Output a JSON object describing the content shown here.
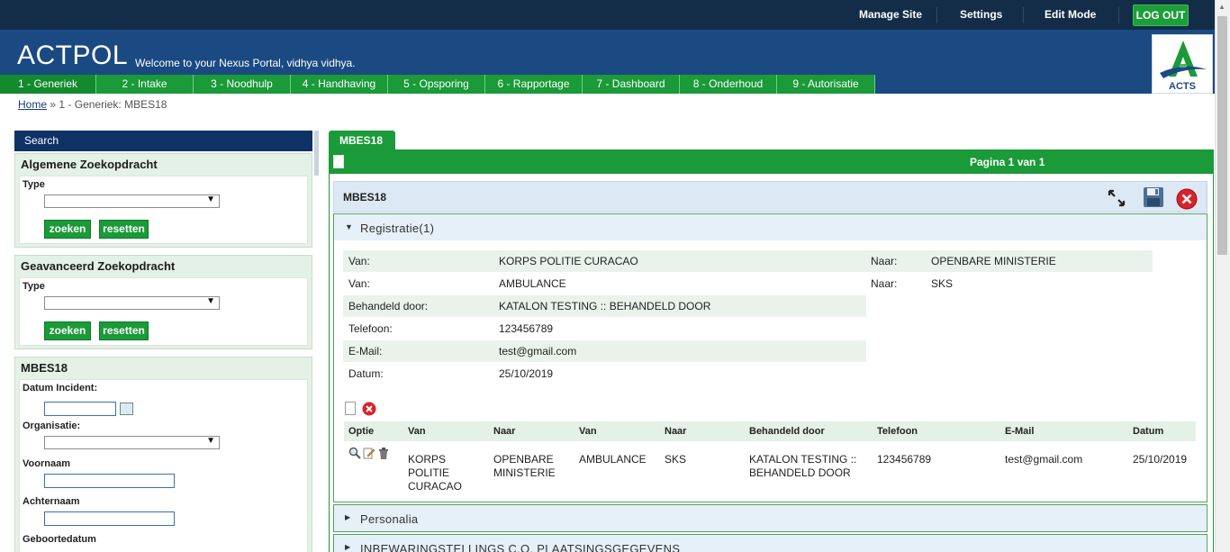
{
  "topbar": {
    "manage_site": "Manage Site",
    "settings": "Settings",
    "edit_mode": "Edit Mode",
    "logout": "LOG OUT"
  },
  "header": {
    "brand": "ACTPOL",
    "welcome": "Welcome to your Nexus Portal, vidhya vidhya.",
    "logo_text": "ACTS"
  },
  "nav": {
    "tabs": [
      {
        "label": "1 - Generiek"
      },
      {
        "label": "2 - Intake"
      },
      {
        "label": "3 - Noodhulp"
      },
      {
        "label": "4 - Handhaving"
      },
      {
        "label": "5 - Opsporing"
      },
      {
        "label": "6 - Rapportage"
      },
      {
        "label": "7 - Dashboard"
      },
      {
        "label": "8 - Onderhoud"
      },
      {
        "label": "9 - Autorisatie"
      }
    ]
  },
  "breadcrumb": {
    "home": "Home",
    "separator": "»",
    "current": "1 - Generiek: MBES18"
  },
  "search": {
    "title": "Search",
    "general": {
      "title": "Algemene Zoekopdracht",
      "type_label": "Type",
      "search_button": "zoeken",
      "reset_button": "resetten"
    },
    "advanced": {
      "title": "Geavanceerd Zoekopdracht",
      "type_label": "Type",
      "search_button": "zoeken",
      "reset_button": "resetten"
    },
    "mbes": {
      "title": "MBES18",
      "datum_label": "Datum Incident:",
      "organisatie_label": "Organisatie:",
      "voornaam_label": "Voornaam",
      "achternaam_label": "Achternaam",
      "geboortedatum_label": "Geboortedatum"
    }
  },
  "main": {
    "tab": "MBES18",
    "pagination": "Pagina 1 van 1",
    "form_title": "MBES18",
    "sections": {
      "registratie": "Registratie(1)",
      "personalia": "Personalia",
      "inbewaring": "INBEWARINGSTELLINGS C.O. PLAATSINGSGEGEVENS"
    },
    "fields": {
      "van1_label": "Van:",
      "van1_value": "KORPS POLITIE CURACAO",
      "naar1_label": "Naar:",
      "naar1_value": "OPENBARE MINISTERIE",
      "van2_label": "Van:",
      "van2_value": "AMBULANCE",
      "naar2_label": "Naar:",
      "naar2_value": "SKS",
      "behandeld_label": "Behandeld door:",
      "behandeld_value": "KATALON TESTING :: BEHANDELD DOOR",
      "telefoon_label": "Telefoon:",
      "telefoon_value": "123456789",
      "email_label": "E-Mail:",
      "email_value": "test@gmail.com",
      "datum_label": "Datum:",
      "datum_value": "25/10/2019"
    },
    "table": {
      "headers": [
        "Optie",
        "Van",
        "Naar",
        "Van",
        "Naar",
        "Behandeld door",
        "Telefoon",
        "E-Mail",
        "Datum"
      ],
      "row": {
        "van1": "KORPS POLITIE CURACAO",
        "naar1": "OPENBARE MINISTERIE",
        "van2": "AMBULANCE",
        "naar2": "SKS",
        "behandeld": "KATALON TESTING :: BEHANDELD DOOR",
        "telefoon": "123456789",
        "email": "test@gmail.com",
        "datum": "25/10/2019"
      }
    }
  },
  "colors": {
    "topbar": "#132d48",
    "header": "#1b4a82",
    "accent_green": "#1a9a38",
    "search_header": "#0e3266"
  }
}
